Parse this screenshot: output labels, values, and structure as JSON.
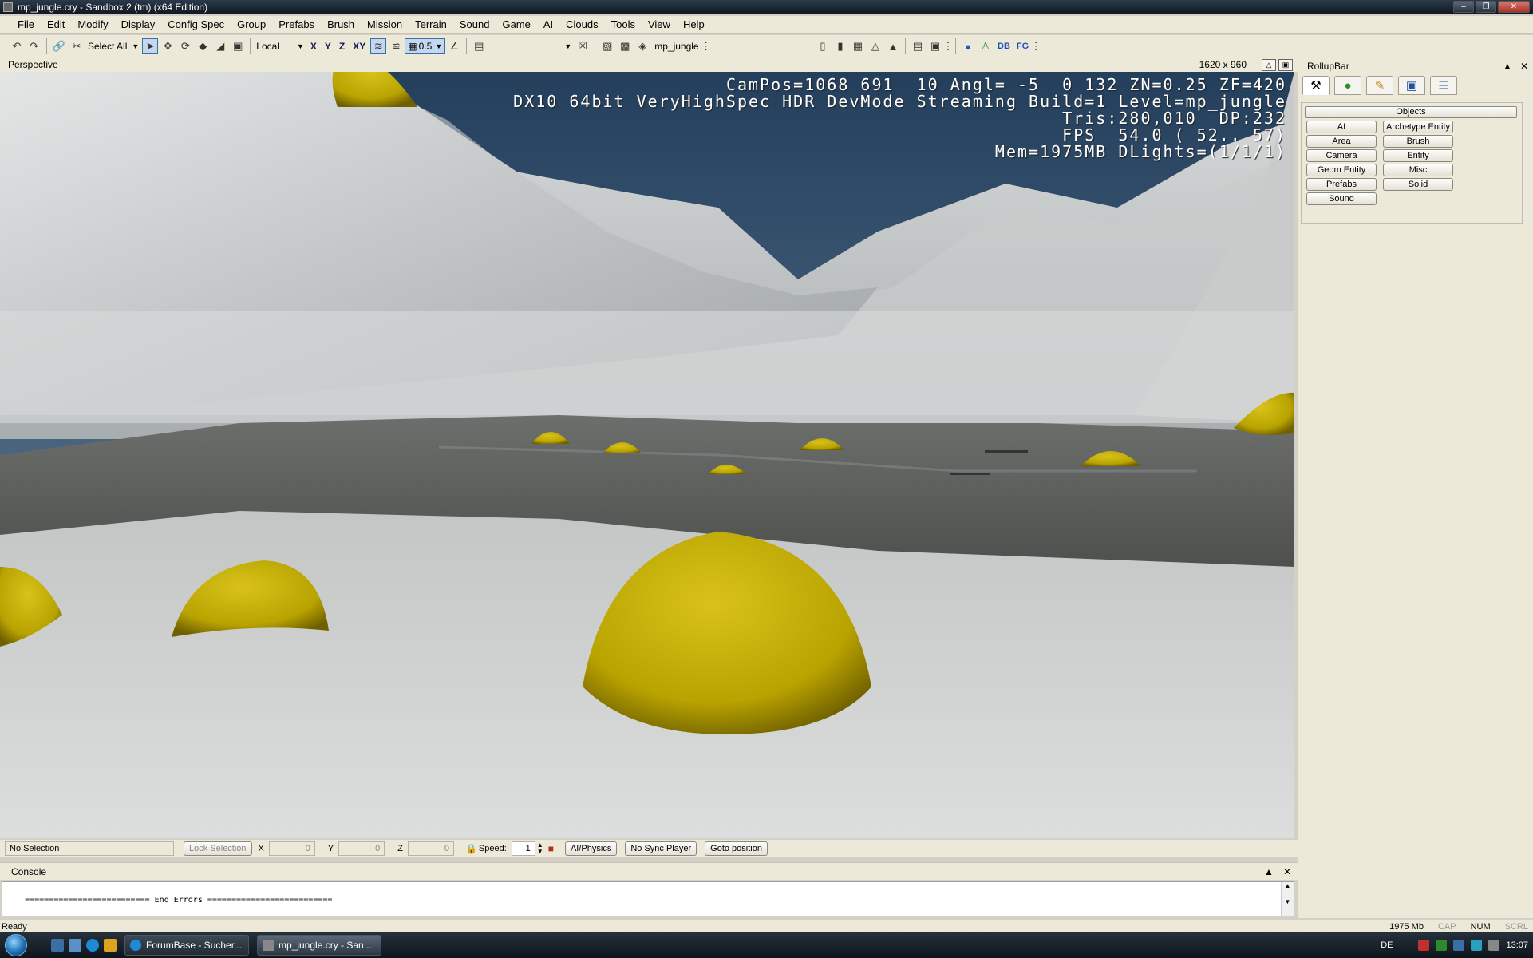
{
  "window": {
    "title": "mp_jungle.cry - Sandbox 2 (tm) (x64 Edition)"
  },
  "menu": [
    "File",
    "Edit",
    "Modify",
    "Display",
    "Config Spec",
    "Group",
    "Prefabs",
    "Brush",
    "Mission",
    "Terrain",
    "Sound",
    "Game",
    "AI",
    "Clouds",
    "Tools",
    "View",
    "Help"
  ],
  "toolbar": {
    "select_all": "Select All",
    "coord_system": "Local",
    "axes": [
      "X",
      "Y",
      "Z",
      "XY"
    ],
    "grid_size": "0.5",
    "level_name": "mp_jungle",
    "db_label": "DB",
    "fg_label": "FG"
  },
  "viewport": {
    "label": "Perspective",
    "resolution": "1620 x 960",
    "hud_lines": [
      "CamPos=1068 691  10 Angl= -5  0 132 ZN=0.25 ZF=420",
      "DX10 64bit VeryHighSpec HDR DevMode Streaming Build=1 Level=mp_jungle",
      "Tris:280,010  DP:232",
      "FPS  54.0 ( 52.. 57)",
      "Mem=1975MB DLights=(1/1/1)"
    ]
  },
  "status_toolbar": {
    "selection": "No Selection",
    "lock_selection": "Lock Selection",
    "x_label": "X",
    "x_value": "0",
    "y_label": "Y",
    "y_value": "0",
    "z_label": "Z",
    "z_value": "0",
    "speed_label": "Speed:",
    "speed_value": "1",
    "ai_physics": "AI/Physics",
    "no_sync": "No Sync Player",
    "goto": "Goto position"
  },
  "console": {
    "title": "Console",
    "line": "========================== End Errors =========================="
  },
  "rollup": {
    "title": "RollupBar",
    "section": "Objects",
    "buttons_left": [
      "AI",
      "Area",
      "Camera",
      "Geom Entity",
      "Prefabs",
      "Sound"
    ],
    "buttons_right": [
      "Archetype Entity",
      "Brush",
      "Entity",
      "Misc",
      "Solid"
    ]
  },
  "statusbar": {
    "ready": "Ready",
    "memory": "1975 Mb",
    "cap": "CAP",
    "num": "NUM",
    "scrl": "SCRL"
  },
  "taskbar": {
    "tasks": [
      "ForumBase - Sucher...",
      "mp_jungle.cry - San..."
    ],
    "language": "DE",
    "clock": "13:07"
  },
  "colors": {
    "dome_yellow": "#d8c21a",
    "sky": "#2f5a80",
    "snow": "#c9cbcb",
    "water": "#5e6460"
  }
}
